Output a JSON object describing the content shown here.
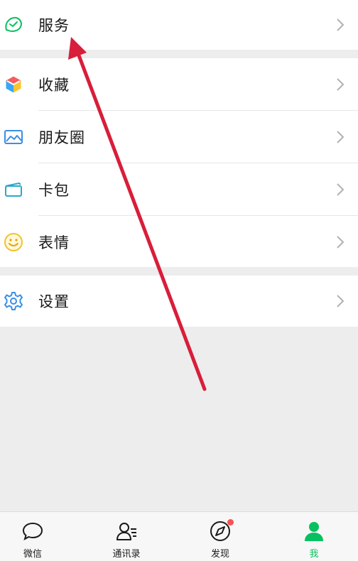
{
  "menu": {
    "services": {
      "label": "服务",
      "icon": "services-icon"
    },
    "favorites": {
      "label": "收藏",
      "icon": "favorites-cube-icon"
    },
    "moments": {
      "label": "朋友圈",
      "icon": "moments-picture-icon"
    },
    "cards": {
      "label": "卡包",
      "icon": "card-wallet-icon"
    },
    "stickers": {
      "label": "表情",
      "icon": "smiley-icon"
    },
    "settings": {
      "label": "设置",
      "icon": "gear-icon"
    }
  },
  "tabbar": {
    "tabs": [
      {
        "label": "微信",
        "icon": "chat-bubble-icon",
        "active": false
      },
      {
        "label": "通讯录",
        "icon": "contacts-icon",
        "active": false
      },
      {
        "label": "发现",
        "icon": "compass-icon",
        "active": false,
        "badge": "dot"
      },
      {
        "label": "我",
        "icon": "person-icon",
        "active": true
      }
    ]
  },
  "colors": {
    "accent": "#07c160",
    "badge": "#fa5151",
    "annotation_arrow": "#d81e3a",
    "background": "#ededed"
  }
}
